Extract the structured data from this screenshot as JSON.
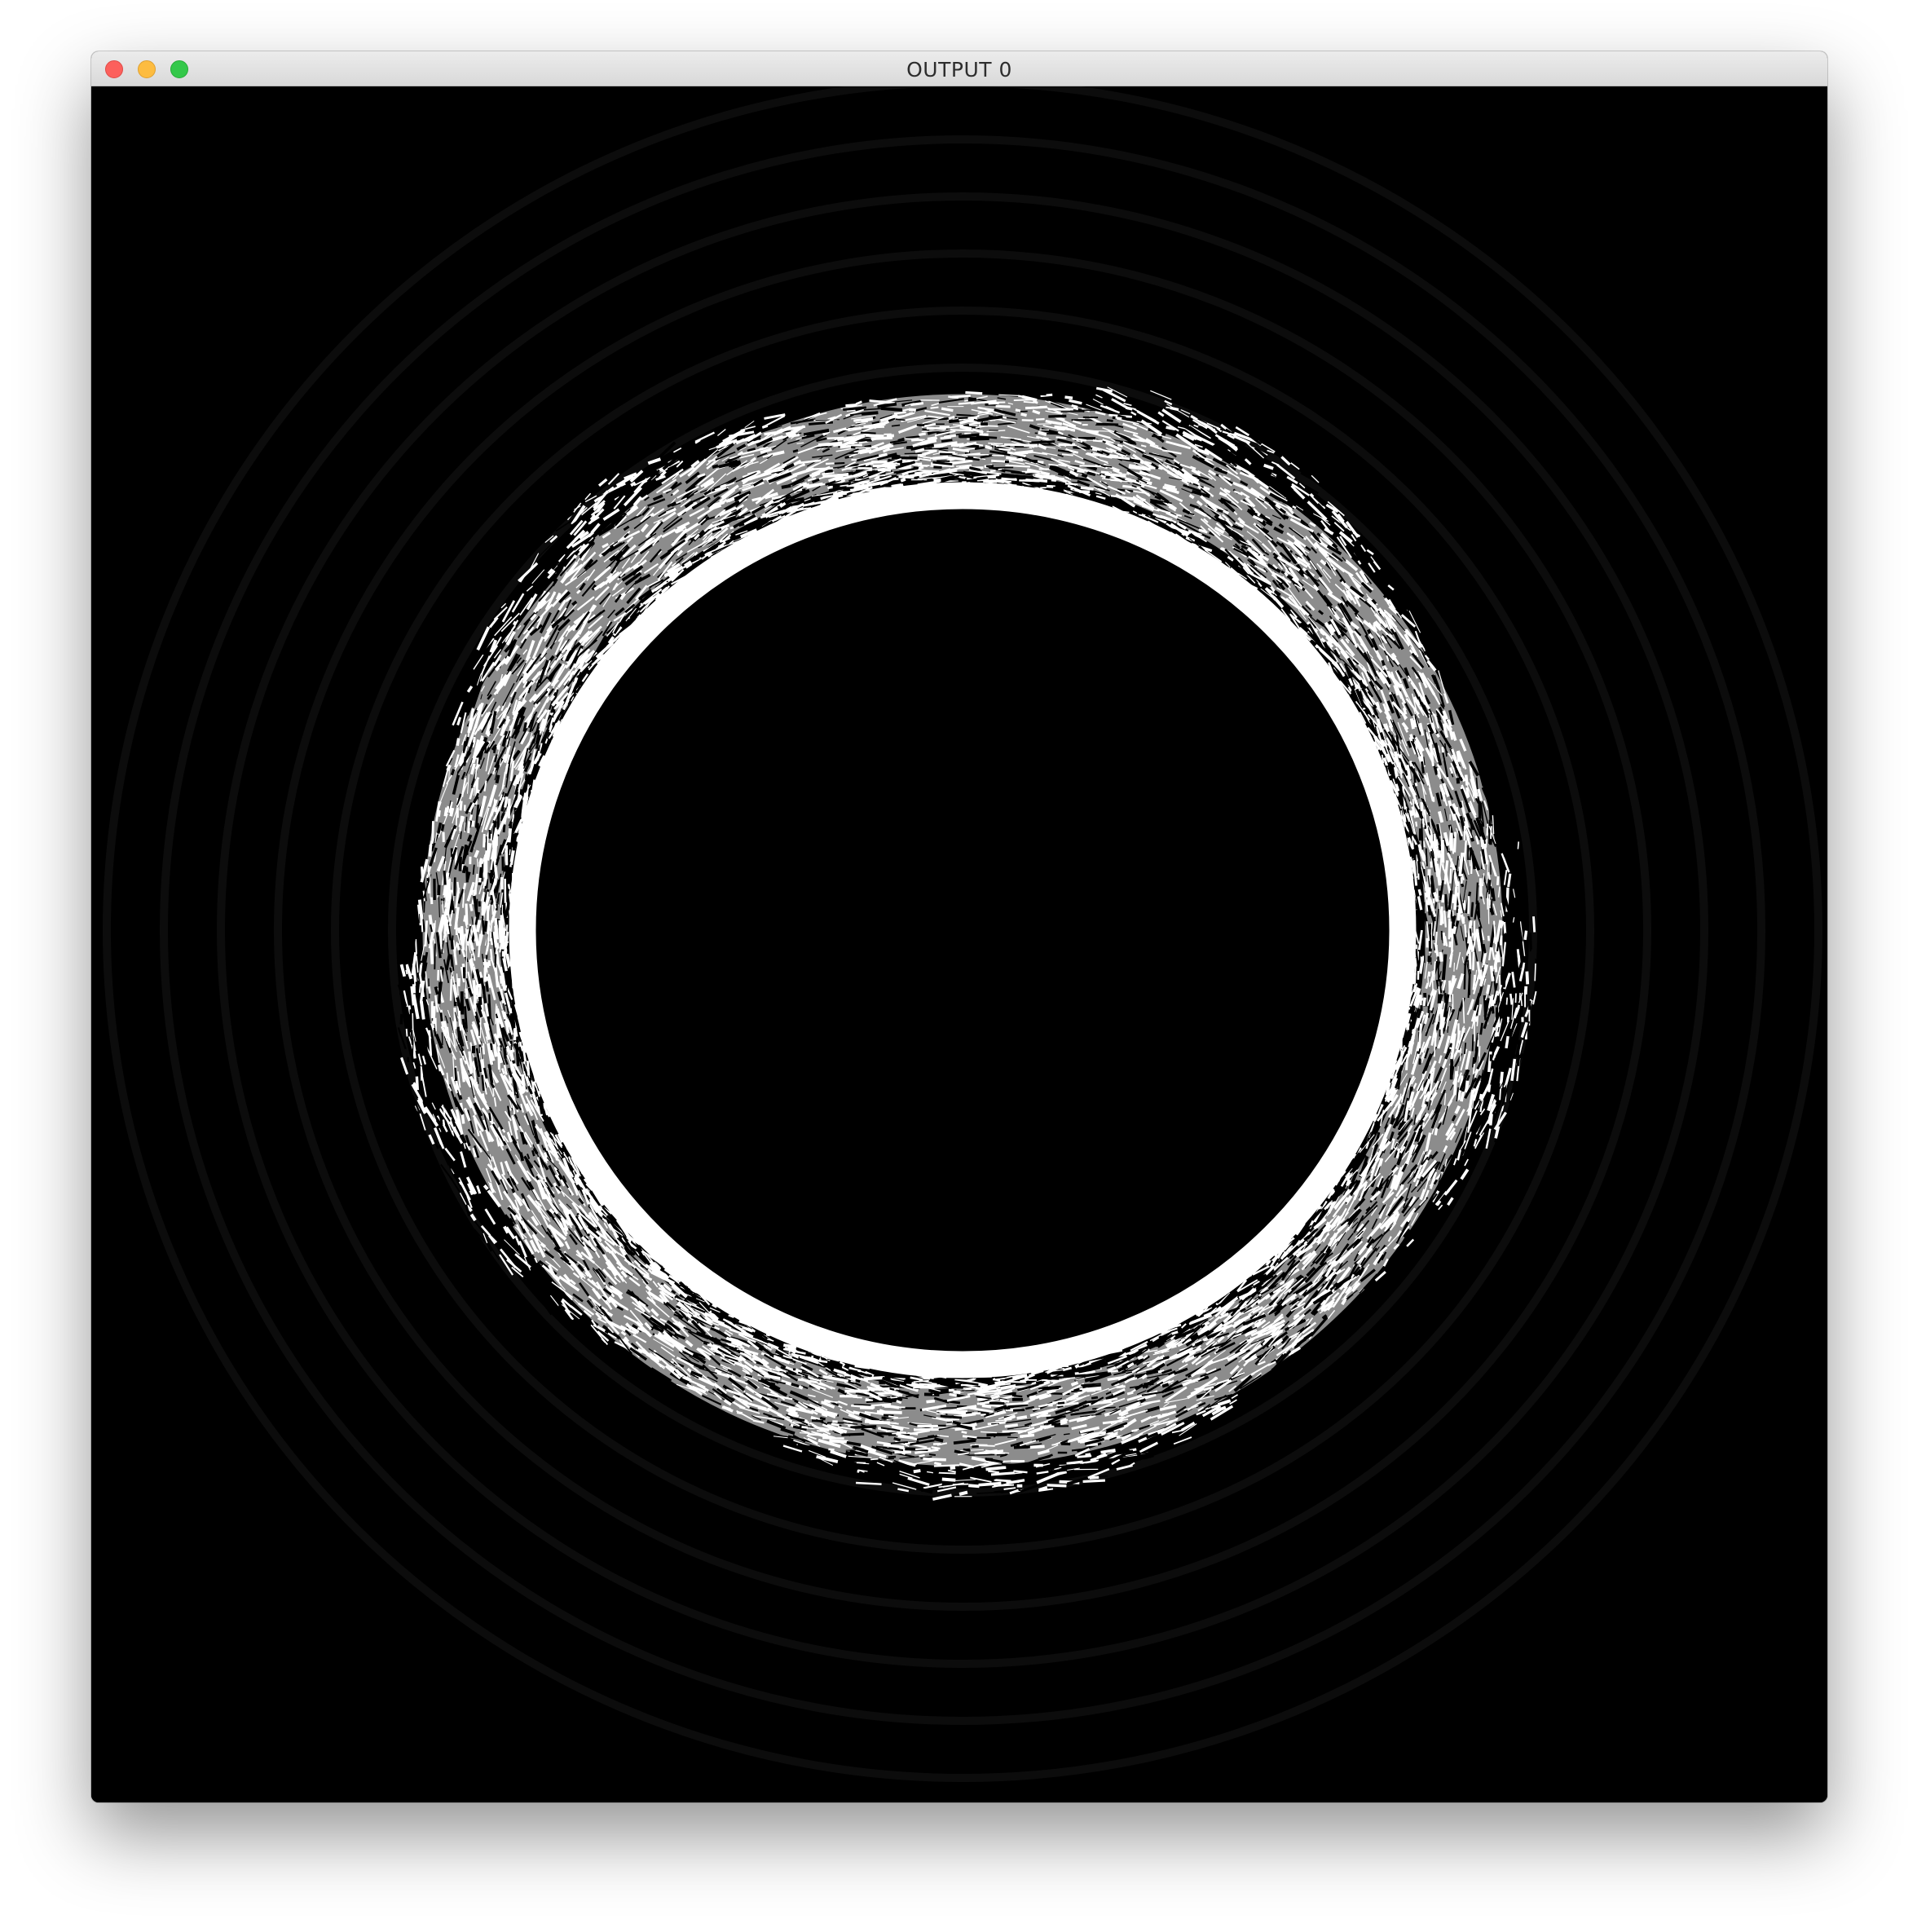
{
  "window": {
    "title": "OUTPUT 0",
    "buttons": {
      "close": "close-icon",
      "minimize": "minimize-icon",
      "zoom": "zoom-icon"
    }
  },
  "canvas": {
    "content": "noisy-white-ring",
    "colors": {
      "background": "#000000",
      "ring": "#ffffff"
    }
  }
}
